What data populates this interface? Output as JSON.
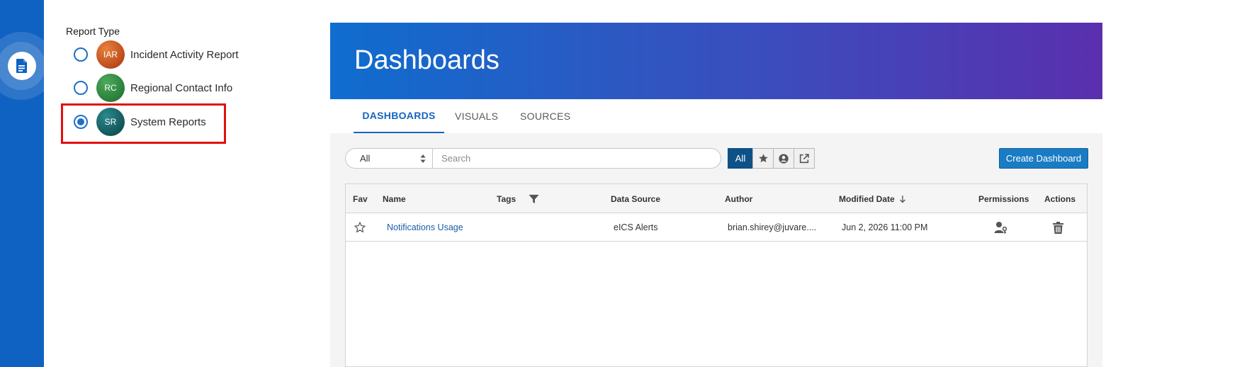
{
  "report_type": {
    "title": "Report Type",
    "items": [
      {
        "abbr": "IAR",
        "label": "Incident Activity Report",
        "selected": false,
        "color": "#c94a1a"
      },
      {
        "abbr": "RC",
        "label": "Regional Contact Info",
        "selected": false,
        "color": "#2a8a3e"
      },
      {
        "abbr": "SR",
        "label": "System Reports",
        "selected": true,
        "color": "#0f5a5e"
      }
    ]
  },
  "rail": {
    "icon": "document-icon"
  },
  "dashboard": {
    "title": "Dashboards",
    "tabs": [
      {
        "label": "DASHBOARDS",
        "active": true
      },
      {
        "label": "VISUALS",
        "active": false
      },
      {
        "label": "SOURCES",
        "active": false
      }
    ],
    "filter_value": "All",
    "search_placeholder": "Search",
    "segments": {
      "all": "All",
      "icons": [
        "star-icon",
        "user-circle-icon",
        "external-link-icon"
      ]
    },
    "create_label": "Create Dashboard",
    "table": {
      "columns": {
        "fav": "Fav",
        "name": "Name",
        "tags": "Tags",
        "data_source": "Data Source",
        "author": "Author",
        "modified": "Modified Date",
        "permissions": "Permissions",
        "actions": "Actions"
      },
      "rows": [
        {
          "name": "Notifications Usage",
          "data_source": "eICS Alerts",
          "author": "brian.shirey@juvare....",
          "modified": "Jun 2, 2026 11:00 PM"
        }
      ]
    }
  },
  "colors": {
    "accent": "#1565c0",
    "rail": "#0f62c2",
    "highlight": "#e01010"
  }
}
